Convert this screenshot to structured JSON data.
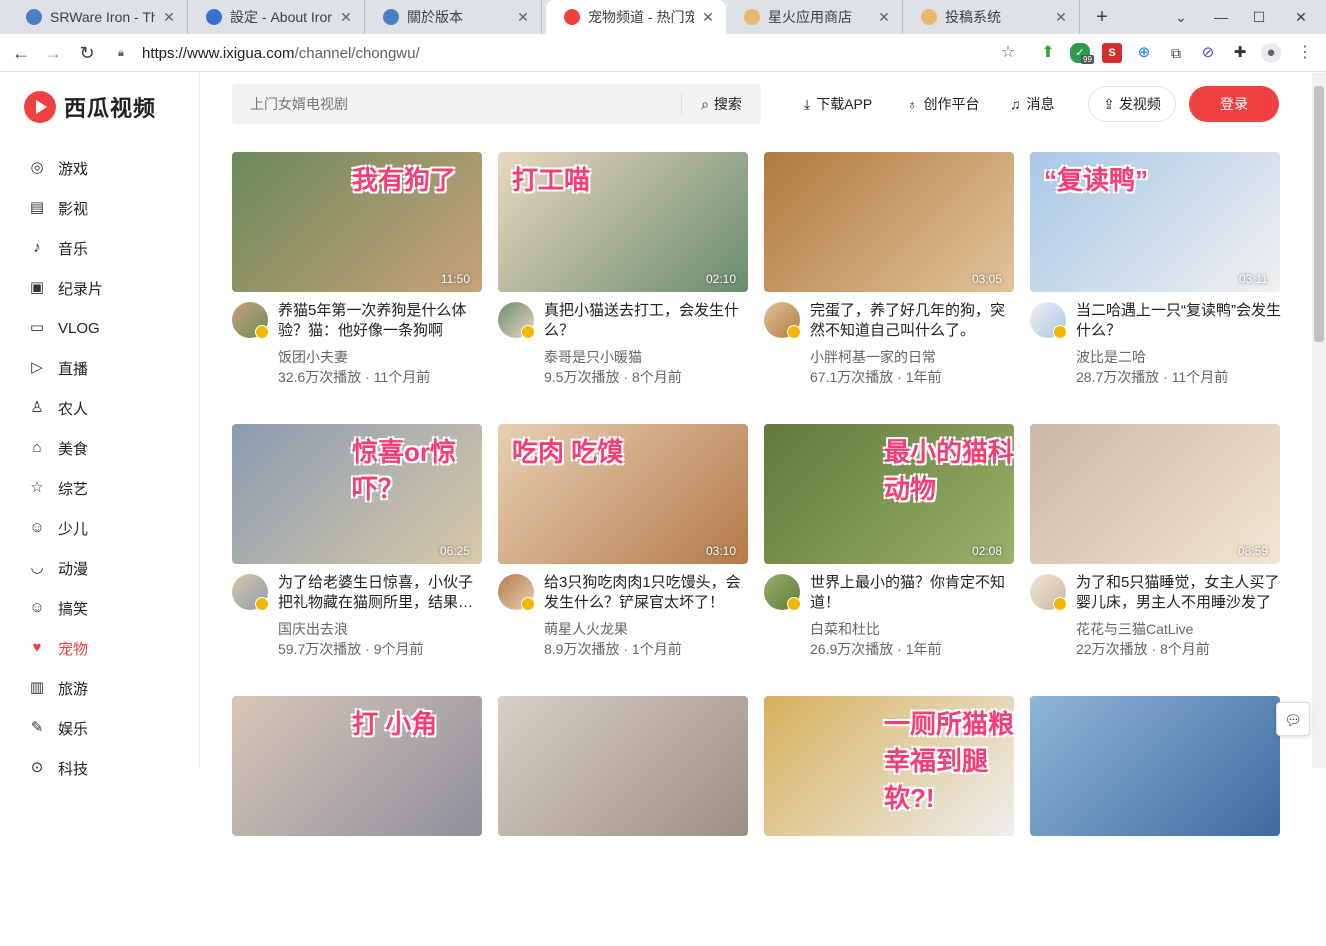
{
  "browser": {
    "tabs": [
      {
        "title": "SRWare Iron - The",
        "color": "#4a7fc1"
      },
      {
        "title": "設定 - About Iron",
        "color": "#3c6fd6"
      },
      {
        "title": "關於版本",
        "color": "#4a7fc1"
      },
      {
        "title": "宠物频道 - 热门宠物",
        "color": "#f04142"
      },
      {
        "title": "星火应用商店",
        "color": "#e9b96e"
      },
      {
        "title": "投稿系统",
        "color": "#e9b96e"
      }
    ],
    "new_tab": "+",
    "url_domain": "https://www.ixigua.com",
    "url_path": "/channel/chongwu/",
    "ext_badge": "99"
  },
  "logo": {
    "text": "西瓜视频"
  },
  "nav": [
    {
      "label": "游戏",
      "icon": "gamepad-icon",
      "glyph": "◎"
    },
    {
      "label": "影视",
      "icon": "film-icon",
      "glyph": "▤"
    },
    {
      "label": "音乐",
      "icon": "music-icon",
      "glyph": "♪"
    },
    {
      "label": "纪录片",
      "icon": "documentary-icon",
      "glyph": "▣"
    },
    {
      "label": "VLOG",
      "icon": "camera-icon",
      "glyph": "▭"
    },
    {
      "label": "直播",
      "icon": "live-icon",
      "glyph": "▷"
    },
    {
      "label": "农人",
      "icon": "farmer-icon",
      "glyph": "♙"
    },
    {
      "label": "美食",
      "icon": "food-icon",
      "glyph": "⌂"
    },
    {
      "label": "综艺",
      "icon": "star-icon",
      "glyph": "☆"
    },
    {
      "label": "少儿",
      "icon": "kid-icon",
      "glyph": "☺"
    },
    {
      "label": "动漫",
      "icon": "anime-icon",
      "glyph": "◡"
    },
    {
      "label": "搞笑",
      "icon": "smile-icon",
      "glyph": "☺"
    },
    {
      "label": "宠物",
      "icon": "pet-icon",
      "glyph": "♥",
      "active": true
    },
    {
      "label": "旅游",
      "icon": "luggage-icon",
      "glyph": "▥"
    },
    {
      "label": "娱乐",
      "icon": "entertainment-icon",
      "glyph": "✎"
    },
    {
      "label": "科技",
      "icon": "tech-icon",
      "glyph": "⊙"
    }
  ],
  "search": {
    "placeholder": "上门女婿电视剧",
    "button": "搜索"
  },
  "topbar": {
    "download": "下载APP",
    "creator": "创作平台",
    "messages": "消息",
    "upload": "发视频",
    "login": "登录"
  },
  "videos": [
    {
      "title": "养猫5年第一次养狗是什么体验？猫：他好像一条狗啊",
      "author": "饭团小夫妻",
      "meta": "32.6万次播放 · 11个月前",
      "duration": "11:50",
      "overlay": "我有狗了",
      "c1": "#6b8a5a",
      "c2": "#c9a27a"
    },
    {
      "title": "真把小猫送去打工，会发生什么？",
      "author": "泰哥是只小暖猫",
      "meta": "9.5万次播放 · 8个月前",
      "duration": "02:10",
      "overlay": "打工喵",
      "c1": "#e8d7c0",
      "c2": "#6a8d6e"
    },
    {
      "title": "完蛋了，养了好几年的狗，突然不知道自己叫什么了。",
      "author": "小胖柯基一家的日常",
      "meta": "67.1万次播放 · 1年前",
      "duration": "03:05",
      "overlay": "",
      "c1": "#b07a3e",
      "c2": "#e2c49a"
    },
    {
      "title": "当二哈遇上一只“复读鸭”会发生什么？",
      "author": "波比是二哈",
      "meta": "28.7万次播放 · 11个月前",
      "duration": "03:11",
      "overlay": "“复读鸭”",
      "c1": "#a8c8e6",
      "c2": "#f0f0f0"
    },
    {
      "title": "为了给老婆生日惊喜，小伙子把礼物藏在猫厕所里，结果…",
      "author": "国庆出去浪",
      "meta": "59.7万次播放 · 9个月前",
      "duration": "06:25",
      "overlay": "惊喜or惊吓？",
      "c1": "#8a9cb0",
      "c2": "#d9c9a8"
    },
    {
      "title": "给3只狗吃肉肉1只吃馒头，会发生什么？铲屎官太坏了！",
      "author": "萌星人火龙果",
      "meta": "8.9万次播放 · 1个月前",
      "duration": "03:10",
      "overlay": "吃肉  吃馍",
      "c1": "#e7d0b3",
      "c2": "#b57a4a"
    },
    {
      "title": "世界上最小的猫？你肯定不知道！",
      "author": "白菜和杜比",
      "meta": "26.9万次播放 · 1年前",
      "duration": "02:08",
      "overlay": "最小的猫科动物",
      "c1": "#5e7a3a",
      "c2": "#9bb06a"
    },
    {
      "title": "为了和5只猫睡觉，女主人买了婴儿床，男主人不用睡沙发了",
      "author": "花花与三猫CatLive",
      "meta": "22万次播放 · 8个月前",
      "duration": "08:59",
      "overlay": "",
      "c1": "#c9b8a4",
      "c2": "#f3e6d4"
    },
    {
      "title": "",
      "author": "",
      "meta": "",
      "duration": "",
      "overlay": "打 小角",
      "c1": "#d8c7b8",
      "c2": "#8f8f9c"
    },
    {
      "title": "",
      "author": "",
      "meta": "",
      "duration": "",
      "overlay": "",
      "c1": "#d9cfc4",
      "c2": "#9c8f86"
    },
    {
      "title": "",
      "author": "",
      "meta": "",
      "duration": "",
      "overlay": "一厕所猫粮 幸福到腿软?!",
      "c1": "#d6b15a",
      "c2": "#eee"
    },
    {
      "title": "",
      "author": "",
      "meta": "",
      "duration": "",
      "overlay": "",
      "c1": "#8fb6d8",
      "c2": "#3f6aa0"
    }
  ]
}
